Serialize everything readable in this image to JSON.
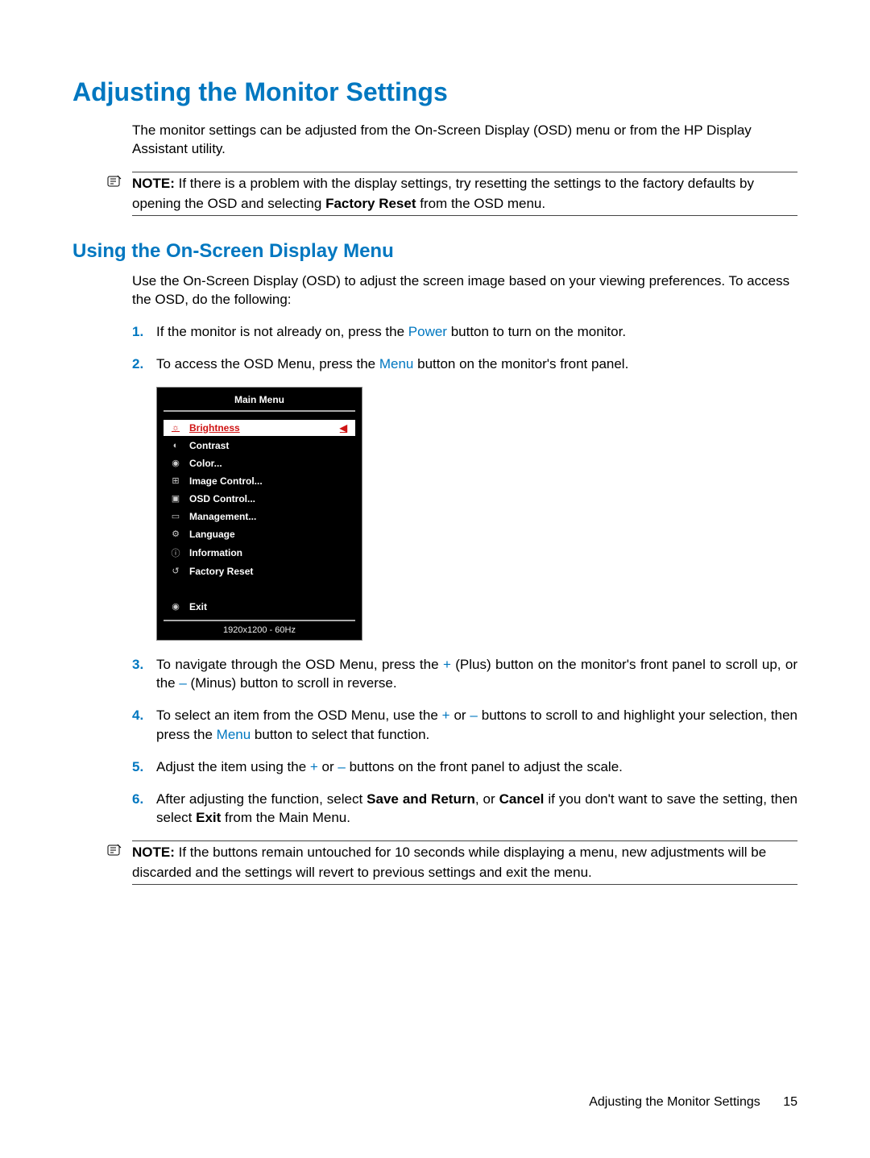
{
  "heading1": "Adjusting the Monitor Settings",
  "intro": "The monitor settings can be adjusted from the On-Screen Display (OSD) menu or from the HP Display Assistant utility.",
  "note1": {
    "label": "NOTE:",
    "pre": "If there is a problem with the display settings, try resetting the settings to the factory defaults by opening the OSD and selecting ",
    "bold": "Factory Reset",
    "post": " from the OSD menu."
  },
  "heading2": "Using the On-Screen Display Menu",
  "intro2": "Use the On-Screen Display (OSD) to adjust the screen image based on your viewing preferences. To access the OSD, do the following:",
  "steps": {
    "s1": {
      "n": "1.",
      "a": "If the monitor is not already on, press the ",
      "b": "Power",
      "c": " button to turn on the monitor."
    },
    "s2": {
      "n": "2.",
      "a": "To access the OSD Menu, press the ",
      "b": "Menu",
      "c": " button on the monitor's front panel."
    },
    "s3": {
      "n": "3.",
      "a": "To navigate through the OSD Menu, press the ",
      "b": "+",
      "c": " (Plus) button on the monitor's front panel to scroll up, or the ",
      "d": "–",
      "e": " (Minus) button to scroll in reverse."
    },
    "s4": {
      "n": "4.",
      "a": "To select an item from the OSD Menu, use the ",
      "b": "+",
      "c": " or ",
      "d": "–",
      "e": " buttons to scroll to and highlight your selection, then press the ",
      "f": "Menu",
      "g": " button to select that function."
    },
    "s5": {
      "n": "5.",
      "a": "Adjust the item using the ",
      "b": "+",
      "c": " or ",
      "d": "–",
      "e": " buttons on the front panel to adjust the scale."
    },
    "s6": {
      "n": "6.",
      "a": "After adjusting the function, select ",
      "b": "Save and Return",
      "c": ", or ",
      "d": "Cancel",
      "e": " if you don't want to save the setting, then select ",
      "f": "Exit",
      "g": " from the Main Menu."
    }
  },
  "osd": {
    "title": "Main Menu",
    "items": {
      "i0": {
        "icon": "☼",
        "label": "Brightness"
      },
      "i1": {
        "icon": "◐",
        "label": "Contrast"
      },
      "i2": {
        "icon": "◉",
        "label": "Color..."
      },
      "i3": {
        "icon": "⊞",
        "label": "Image Control..."
      },
      "i4": {
        "icon": "▣",
        "label": "OSD Control..."
      },
      "i5": {
        "icon": "▭",
        "label": "Management..."
      },
      "i6": {
        "icon": "⚙",
        "label": "Language"
      },
      "i7": {
        "icon": "ⓘ",
        "label": "Information"
      },
      "i8": {
        "icon": "↺",
        "label": "Factory Reset"
      },
      "i9": {
        "icon": "◉",
        "label": "Exit"
      }
    },
    "arrow": "◀",
    "footer": "1920x1200 - 60Hz"
  },
  "note2": {
    "label": "NOTE:",
    "text": "If the buttons remain untouched for 10 seconds while displaying a menu, new adjustments will be discarded and the settings will revert to previous settings and exit the menu."
  },
  "footer": {
    "label": "Adjusting the Monitor Settings",
    "page": "15"
  }
}
